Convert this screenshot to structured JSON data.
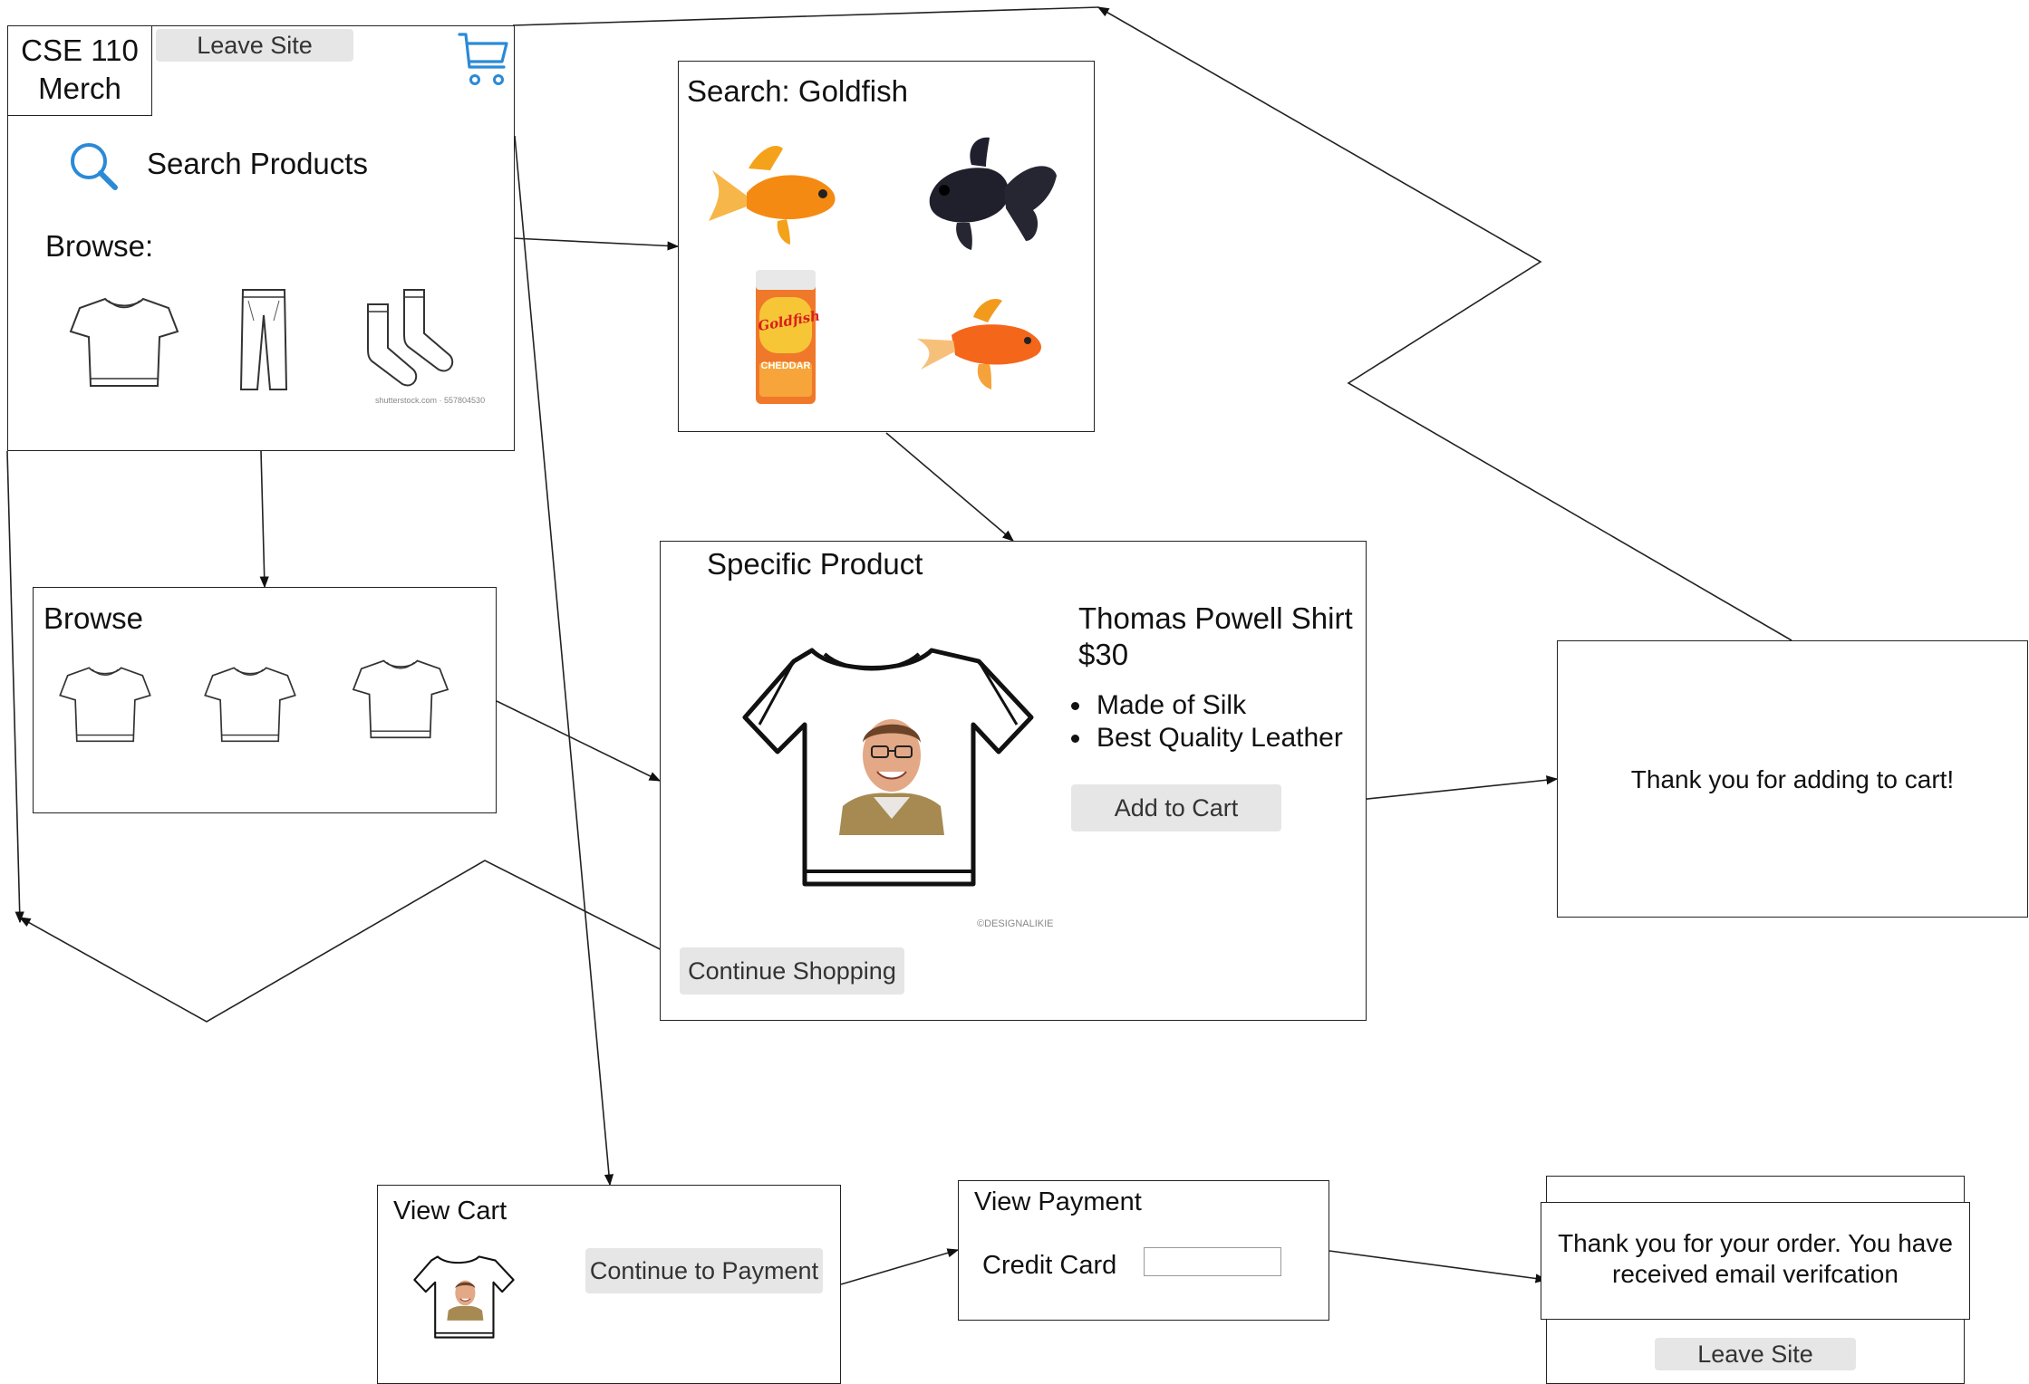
{
  "home": {
    "logo_line1": "CSE 110",
    "logo_line2": "Merch",
    "leave_site_label": "Leave Site",
    "search_label": "Search Products",
    "browse_label": "Browse:",
    "socks_credit": "shutterstock.com · 557804530"
  },
  "search": {
    "title": "Search: Goldfish",
    "cracker_brand": "Goldfish",
    "cracker_flavor": "CHEDDAR"
  },
  "browse": {
    "title": "Browse"
  },
  "product": {
    "section_title": "Specific Product",
    "name": "Thomas Powell Shirt",
    "price": "$30",
    "features": [
      "Made of Silk",
      "Best Quality Leather"
    ],
    "add_to_cart_label": "Add to Cart",
    "continue_shopping_label": "Continue Shopping",
    "image_credit": "©DESIGNALIKIE"
  },
  "added": {
    "message": "Thank you for adding to cart!"
  },
  "cart": {
    "title": "View Cart",
    "continue_label": "Continue to Payment"
  },
  "payment": {
    "title": "View Payment",
    "credit_card_label": "Credit Card",
    "credit_card_value": ""
  },
  "order": {
    "message_line1": "Thank you for your order. You have",
    "message_line2": "received email verifcation",
    "leave_site_label": "Leave Site"
  },
  "colors": {
    "accent_blue": "#2b8ad6",
    "button_gray": "#e6e6e6"
  }
}
